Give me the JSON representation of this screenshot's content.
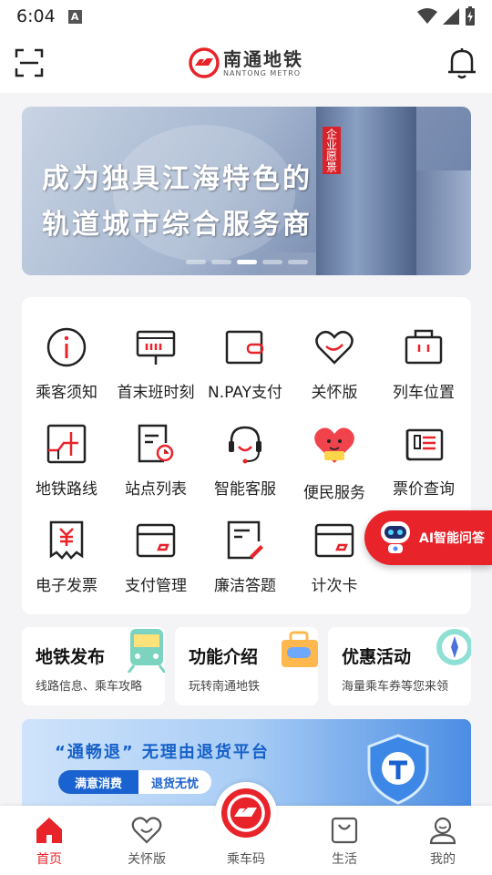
{
  "status_bar": {
    "time": "6:04",
    "notification_icon": "A"
  },
  "header": {
    "logo_cn": "南通地铁",
    "logo_en": "NANTONG METRO"
  },
  "banner": {
    "line1": "成为独具江海特色的",
    "line2": "轨道城市综合服务商",
    "badge": "企业愿景",
    "slide_count": 5,
    "active_slide": 3
  },
  "grid": [
    {
      "label": "乘客须知",
      "icon": "info-icon"
    },
    {
      "label": "首末班时刻",
      "icon": "timetable-icon"
    },
    {
      "label": "N.PAY支付",
      "icon": "wallet-icon"
    },
    {
      "label": "关怀版",
      "icon": "heart-icon"
    },
    {
      "label": "列车位置",
      "icon": "train-position-icon"
    },
    {
      "label": "地铁路线",
      "icon": "metro-route-icon"
    },
    {
      "label": "站点列表",
      "icon": "station-list-icon"
    },
    {
      "label": "智能客服",
      "icon": "customer-service-icon"
    },
    {
      "label": "便民服务",
      "icon": "convenience-heart-icon"
    },
    {
      "label": "票价查询",
      "icon": "fare-query-icon"
    },
    {
      "label": "电子发票",
      "icon": "e-invoice-icon"
    },
    {
      "label": "支付管理",
      "icon": "card-icon"
    },
    {
      "label": "廉洁答题",
      "icon": "quiz-icon"
    },
    {
      "label": "计次卡",
      "icon": "count-card-icon"
    }
  ],
  "ai_button": {
    "label": "AI智能问答"
  },
  "features": [
    {
      "title": "地铁发布",
      "subtitle": "线路信息、乘车攻略"
    },
    {
      "title": "功能介绍",
      "subtitle": "玩转南通地铁"
    },
    {
      "title": "优惠活动",
      "subtitle": "海量乘车券等您来领"
    }
  ],
  "promo": {
    "title": "“通畅退” 无理由退货平台",
    "pill1": "满意消费",
    "pill2": "退货无忧"
  },
  "tabbar": [
    {
      "label": "首页",
      "active": true
    },
    {
      "label": "关怀版",
      "active": false
    },
    {
      "label": "乘车码",
      "active": false
    },
    {
      "label": "生活",
      "active": false
    },
    {
      "label": "我的",
      "active": false
    }
  ],
  "colors": {
    "brand_red": "#e8232a",
    "promo_blue": "#1a62cf"
  }
}
